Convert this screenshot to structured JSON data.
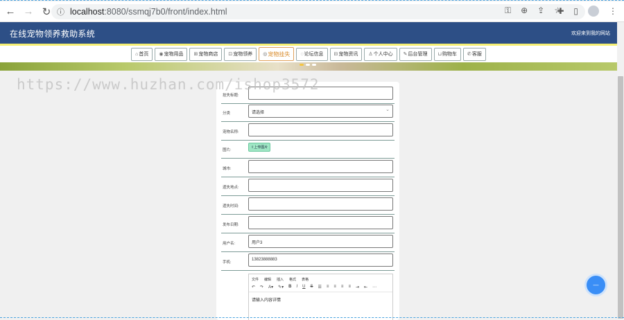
{
  "browser": {
    "url_host": "localhost",
    "url_path": ":8080/ssmqj7b0/front/index.html"
  },
  "site": {
    "title": "在线宠物领养救助系统",
    "welcome": "欢迎来到我的网站"
  },
  "menu": [
    {
      "label": "首页",
      "icon": "home-icon"
    },
    {
      "label": "宠物用品",
      "icon": "goods-icon"
    },
    {
      "label": "宠物商店",
      "icon": "shop-icon"
    },
    {
      "label": "宠物领养",
      "icon": "adopt-icon"
    },
    {
      "label": "宠物挂失",
      "icon": "lost-icon",
      "active": true
    },
    {
      "label": "论坛信息",
      "icon": "forum-icon"
    },
    {
      "label": "宠物资讯",
      "icon": "news-icon"
    },
    {
      "label": "个人中心",
      "icon": "user-icon"
    },
    {
      "label": "后台管理",
      "icon": "admin-icon"
    },
    {
      "label": "购物车",
      "icon": "cart-icon"
    },
    {
      "label": "客服",
      "icon": "service-icon"
    }
  ],
  "watermark": "https://www.huzhan.com/ishop3572",
  "form": {
    "fields": [
      {
        "label": "挂失标题:",
        "value": "",
        "type": "text"
      },
      {
        "label": "分类",
        "value": "请选择",
        "type": "select"
      },
      {
        "label": "宠物名称:",
        "value": "",
        "type": "text"
      },
      {
        "label": "图片:",
        "value": "上传图片",
        "type": "upload"
      },
      {
        "label": "城市:",
        "value": "",
        "type": "text"
      },
      {
        "label": "遗失地点:",
        "value": "",
        "type": "text"
      },
      {
        "label": "遗失时间:",
        "value": "",
        "type": "text"
      },
      {
        "label": "发布日期:",
        "value": "",
        "type": "text"
      },
      {
        "label": "用户名:",
        "value": "用户3",
        "type": "text"
      },
      {
        "label": "手机:",
        "value": "13823888883",
        "type": "text"
      }
    ],
    "editor": {
      "menu": [
        "文件",
        "编辑",
        "插入",
        "格式",
        "表格"
      ],
      "placeholder": "请输入内容详情"
    }
  },
  "colors": {
    "header": "#2d4f86",
    "accent_line": "#f5ef73",
    "active_menu": "#d98b2b",
    "upload_button": "#9fe6c4"
  }
}
